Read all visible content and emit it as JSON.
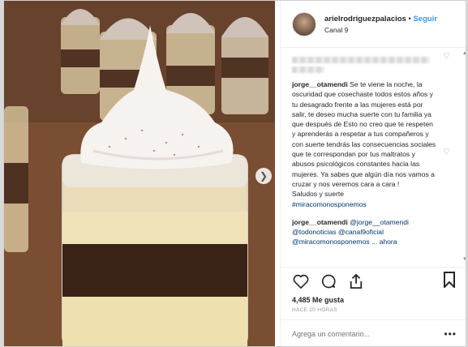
{
  "header": {
    "username": "arielrodriguezpalacios",
    "separator": "•",
    "follow_label": "Seguir",
    "location": "Canal 9"
  },
  "comments": [
    {
      "user": "jorge__otamendi",
      "text": "Se te viene la noche, la oscuridad que cosechaste todos estos años y tu desagrado frente a las mujeres está por salir, te deseo mucha suerte con tu familia ya que después de Esto no creo que te respeten y aprenderás a respetar a tus compañeros y con suerte tendrás las consecuencias sociales que te correspondan por tus maltratos y abusos psicológicos constantes hacia las mujeres. Ya sabes que algún día nos vamos a cruzar y nos veremos cara a cara !",
      "closing": "Saludos y suerte",
      "hashtag": "#miracomonosponemos"
    },
    {
      "user": "jorge__otamendi",
      "mentions": "@jorge__otamendi @todonoticias @canal9oficial @miracomonosponemos ... ahora"
    }
  ],
  "likes": "4,485 Me gusta",
  "time": "HACE 20 HORAS",
  "add_comment_placeholder": "Agrega un comentario...",
  "more_label": "•••",
  "icons": [
    "heart-icon",
    "comment-icon",
    "share-icon",
    "bookmark-icon",
    "chevron-right-icon"
  ]
}
